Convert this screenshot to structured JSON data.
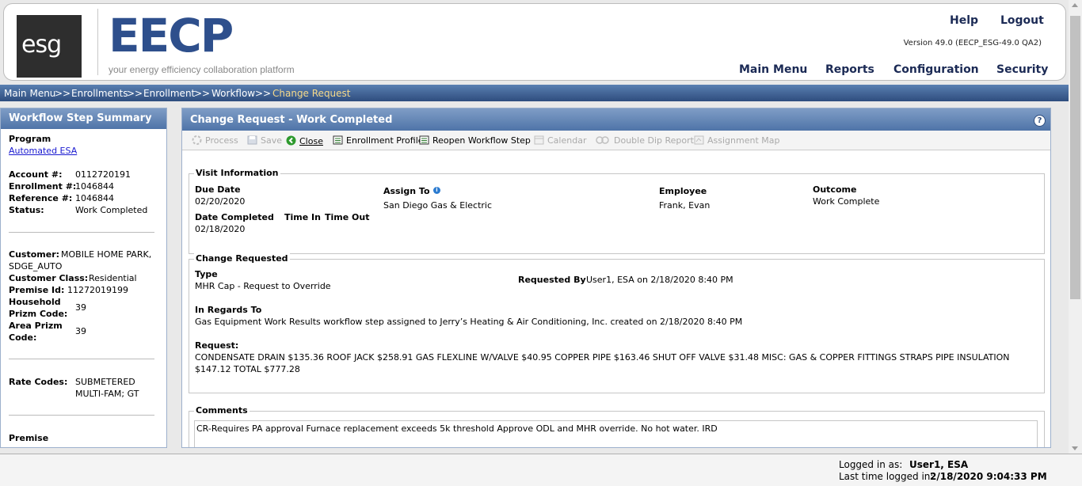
{
  "header": {
    "logo_text": "esg",
    "app_logo": "EECP",
    "tagline": "your energy efficiency collaboration platform",
    "help": "Help",
    "logout": "Logout",
    "version": "Version 49.0 (EECP_ESG-49.0 QA2)",
    "nav": [
      "Main Menu",
      "Reports",
      "Configuration",
      "Security"
    ]
  },
  "breadcrumb": {
    "items": [
      "Main Menu",
      "Enrollments",
      "Enrollment",
      "Workflow"
    ],
    "separator": ">>",
    "current": "Change Request"
  },
  "sidebar": {
    "title": "Workflow Step Summary",
    "program_label": "Program",
    "program_value": "Automated ESA",
    "account_label": "Account #:",
    "account_value": "0112720191",
    "enrollment_label": "Enrollment #:",
    "enrollment_value": "1046844",
    "reference_label": "Reference #:",
    "reference_value": "1046844",
    "status_label": "Status:",
    "status_value": "Work Completed",
    "customer_label": "Customer:",
    "customer_value_1": "MOBILE HOME PARK,",
    "customer_value_2": "SDGE_AUTO",
    "customer_class_label": "Customer Class:",
    "customer_class_value": "Residential",
    "premise_id_label": "Premise Id:",
    "premise_id_value": "11272019199",
    "household_prizm_label_1": "Household",
    "household_prizm_label_2": "Prizm Code:",
    "household_prizm_value": "39",
    "area_prizm_label_1": "Area Prizm",
    "area_prizm_label_2": "Code:",
    "area_prizm_value": "39",
    "rate_codes_label": "Rate Codes:",
    "rate_codes_value_1": "SUBMETERED",
    "rate_codes_value_2": "MULTI-FAM; GT",
    "premise_label": "Premise"
  },
  "panel": {
    "title": "Change Request - Work Completed",
    "toolbar": {
      "process": "Process",
      "save": "Save",
      "close": "Close",
      "enrollment_profile": "Enrollment Profile",
      "reopen": "Reopen Workflow Step",
      "calendar": "Calendar",
      "double_dip": "Double Dip Report",
      "assignment_map": "Assignment Map"
    },
    "visit": {
      "legend": "Visit Information",
      "due_date_label": "Due Date",
      "due_date": "02/20/2020",
      "date_completed_label": "Date Completed",
      "date_completed": "02/18/2020",
      "time_in_label": "Time In",
      "time_out_label": "Time Out",
      "assign_to_label": "Assign To",
      "assign_to": "San Diego Gas & Electric",
      "employee_label": "Employee",
      "employee": "Frank, Evan",
      "outcome_label": "Outcome",
      "outcome": "Work Complete"
    },
    "change": {
      "legend": "Change Requested",
      "type_label": "Type",
      "type_value": "MHR Cap - Request to Override",
      "requested_by_label": "Requested By",
      "requested_by_value": "User1, ESA on 2/18/2020 8:40 PM",
      "regards_label": "In Regards To",
      "regards_value": "Gas Equipment Work Results workflow step assigned to Jerry’s Heating & Air Conditioning, Inc. created on 2/18/2020 8:40 PM",
      "request_label": "Request:",
      "request_line1": "CONDENSATE DRAIN $135.36 ROOF JACK $258.91 GAS FLEXLINE W/VALVE $40.95 COPPER PIPE $163.46 SHUT OFF VALVE $31.48 MISC: GAS & COPPER FITTINGS STRAPS PIPE INSULATION",
      "request_line2": "$147.12 TOTAL $777.28"
    },
    "comments": {
      "legend": "Comments",
      "text": "CR-Requires PA approval Furnace replacement exceeds 5k threshold Approve ODL and MHR override. No hot water. IRD"
    }
  },
  "footer": {
    "logged_in_label": "Logged in as:",
    "logged_in_value": "User1, ESA",
    "last_login_label": "Last time logged in:",
    "last_login_value": "2/18/2020 9:04:33 PM"
  },
  "colors": {
    "brand_blue": "#2e4f8c",
    "nav_text": "#1b2a55",
    "breadcrumb_current": "#f5d98a",
    "esg_green": "#6fbf2a"
  }
}
